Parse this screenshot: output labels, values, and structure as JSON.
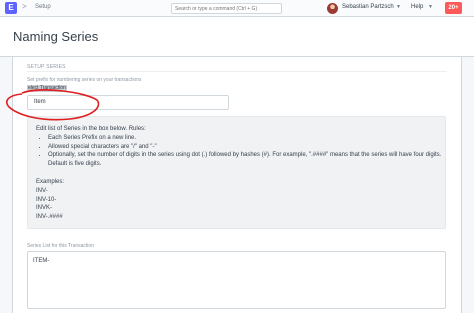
{
  "navbar": {
    "logo_letter": "E",
    "breadcrumb_separator": ">",
    "breadcrumb": "Setup",
    "search_placeholder": "Search or type a command (Ctrl + G)",
    "user_name": "Sebastian Partzsch",
    "help_label": "Help",
    "notifications": "20+"
  },
  "page": {
    "title": "Naming Series"
  },
  "section": {
    "heading": "SETUP SERIES",
    "description": "Set prefix for numbering series on your transactions",
    "select_label": "elect Transaction",
    "select_value": "Item"
  },
  "help": {
    "intro": "Edit list of Series in the box below. Rules:",
    "rules": [
      "Each Series Prefix on a new line.",
      "Allowed special characters are \"/\" and \"-\"",
      "Optionally, set the number of digits in the series using dot (.) followed by hashes (#). For example, \".####\" means that the series will have four digits. Default is five digits."
    ],
    "examples_title": "Examples:",
    "examples": [
      "INV-",
      "INV-10-",
      "INVK-",
      "INV-.####"
    ]
  },
  "series": {
    "label": "Series List for this Transaction",
    "value": "ITEM-"
  },
  "colors": {
    "brand": "#5e64ff",
    "notification": "#ff5858",
    "annotation": "#e02020"
  }
}
